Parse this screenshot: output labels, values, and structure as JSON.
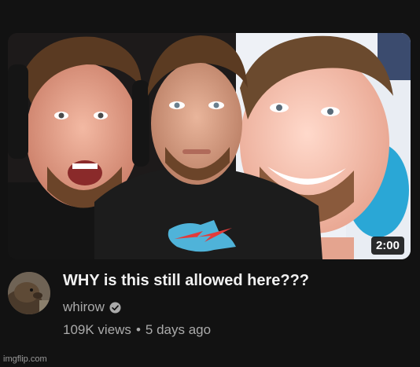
{
  "video": {
    "title": "WHY is this still allowed here???",
    "duration": "2:00",
    "channel": "whirow",
    "views": "109K views",
    "separator": "•",
    "age": "5 days ago",
    "verified_icon": "verified-check-icon"
  },
  "watermark": "imgflip.com",
  "colors": {
    "background": "#121212",
    "title": "#f1f1f1",
    "secondary_text": "#aaaaaa",
    "shirt_logo_blue": "#4fb3d9",
    "shirt_logo_red": "#e23b3b"
  }
}
